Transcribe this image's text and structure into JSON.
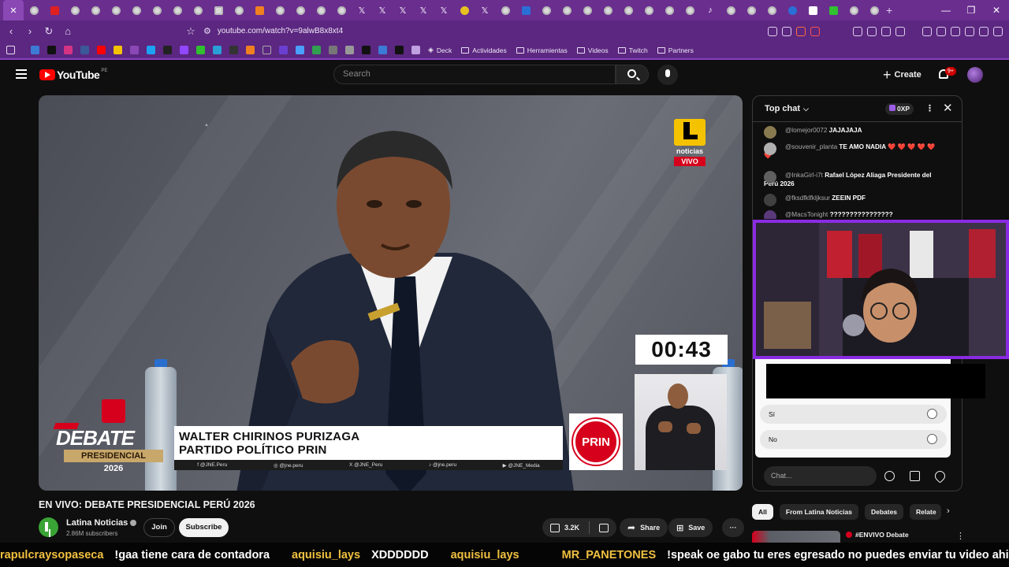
{
  "browser": {
    "url": "youtube.com/watch?v=9alwB8x8xt4",
    "new_tab": "+",
    "window_controls": [
      "—",
      "❐",
      "✕"
    ],
    "bookmarks": [
      {
        "label": "Deck"
      },
      {
        "label": "Actividades"
      },
      {
        "label": "Herramientas"
      },
      {
        "label": "Videos"
      },
      {
        "label": "Twitch"
      },
      {
        "label": "Partners"
      }
    ]
  },
  "youtube": {
    "logo_text": "YouTube",
    "country_code": "PE",
    "search_placeholder": "Search",
    "create_label": "Create",
    "notifications_badge": "9+"
  },
  "video": {
    "title": "EN VIVO: DEBATE PRESIDENCIAL PERÚ 2026",
    "overlay": {
      "brand_sub": "noticias",
      "live": "VIVO",
      "timer": "00:43",
      "debate_line1": "DEBATE",
      "debate_line2": "PRESIDENCIAL",
      "debate_year": "2026",
      "name_line1": "WALTER CHIRINOS PURIZAGA",
      "name_line2": "PARTIDO POLÍTICO PRIN",
      "party_logo": "PRIN",
      "socials": [
        "f @JNE.Peru",
        "◎ @jne.peru",
        "X @JNE_Peru",
        "♪ @jne.peru",
        "▶ @JNE_Media"
      ]
    },
    "channel": {
      "name": "Latina Noticias",
      "subscribers": "2.86M subscribers",
      "join_label": "Join",
      "subscribe_label": "Subscribe"
    },
    "actions": {
      "likes": "3.2K",
      "share": "Share",
      "save": "Save",
      "more": "···"
    }
  },
  "chat": {
    "mode": "Top chat",
    "xp": "0XP",
    "messages": [
      {
        "user": "@lomejor0072",
        "text": "JAJAJAJA"
      },
      {
        "user": "@souvenir_planta",
        "text": "TE AMO NADIA ❤️ ❤️ ❤️ ❤️ ❤️ ❤️"
      },
      {
        "user": "@InkaGirl-i7t",
        "text": "Rafael López Aliaga Presidente del Perú 2026"
      },
      {
        "user": "@fksdfklfkljksur",
        "text": "ZEEIN PDF"
      },
      {
        "user": "@MacsTonight",
        "text": "????????????????"
      }
    ],
    "poll_options": [
      "Sí",
      "No"
    ],
    "input_placeholder": "Chat..."
  },
  "related": {
    "chips": [
      "All",
      "From Latina Noticias",
      "Debates",
      "Relate"
    ],
    "first_title": "#ENVIVO Debate"
  },
  "ticker": [
    {
      "user": "rapulcraysopaseca",
      "msg": "!gaa tiene cara de contadora"
    },
    {
      "user": "aquisiu_lays",
      "msg": "XDDDDDD"
    },
    {
      "user": "aquisiu_lays",
      "msg": ""
    },
    {
      "user": "MR_PANETONES",
      "msg": "!speak oe gabo tu eres egresado no puedes enviar tu video ahi"
    }
  ],
  "colors": {
    "browser_purple": "#5b2780",
    "youtube_red": "#ff0000",
    "live_red": "#d6001c",
    "brand_yellow": "#f5c200",
    "streamer_border": "#8a2be2",
    "ticker_user": "#f0c040"
  }
}
